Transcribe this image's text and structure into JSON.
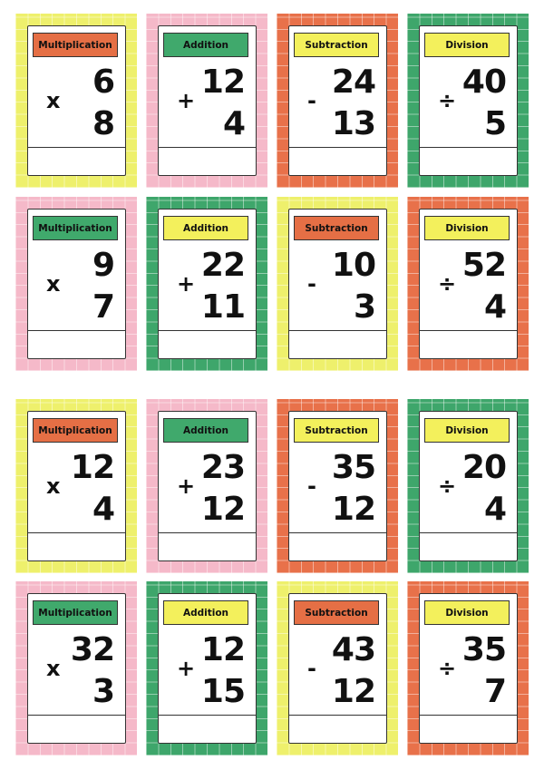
{
  "colors": {
    "yellow": "#eef06c",
    "pink": "#f5b9c9",
    "orange": "#e8714a",
    "green": "#3ea66b",
    "label_yellow": "#f3f05c",
    "label_orange": "#e56f45",
    "label_green": "#40a96c"
  },
  "cards": [
    {
      "label": "Multiplication",
      "top": "6",
      "bottom": "8",
      "op": "x",
      "bg": "yellow",
      "label_color": "label_orange"
    },
    {
      "label": "Addition",
      "top": "12",
      "bottom": "4",
      "op": "+",
      "bg": "pink",
      "label_color": "label_green"
    },
    {
      "label": "Subtraction",
      "top": "24",
      "bottom": "13",
      "op": "-",
      "bg": "orange",
      "label_color": "label_yellow"
    },
    {
      "label": "Division",
      "top": "40",
      "bottom": "5",
      "op": "÷",
      "bg": "green",
      "label_color": "label_yellow"
    },
    {
      "label": "Multiplication",
      "top": "9",
      "bottom": "7",
      "op": "x",
      "bg": "pink",
      "label_color": "label_green"
    },
    {
      "label": "Addition",
      "top": "22",
      "bottom": "11",
      "op": "+",
      "bg": "green",
      "label_color": "label_yellow"
    },
    {
      "label": "Subtraction",
      "top": "10",
      "bottom": "3",
      "op": "-",
      "bg": "yellow",
      "label_color": "label_orange"
    },
    {
      "label": "Division",
      "top": "52",
      "bottom": "4",
      "op": "÷",
      "bg": "orange",
      "label_color": "label_yellow"
    },
    {
      "label": "Multiplication",
      "top": "12",
      "bottom": "4",
      "op": "x",
      "bg": "yellow",
      "label_color": "label_orange"
    },
    {
      "label": "Addition",
      "top": "23",
      "bottom": "12",
      "op": "+",
      "bg": "pink",
      "label_color": "label_green"
    },
    {
      "label": "Subtraction",
      "top": "35",
      "bottom": "12",
      "op": "-",
      "bg": "orange",
      "label_color": "label_yellow"
    },
    {
      "label": "Division",
      "top": "20",
      "bottom": "4",
      "op": "÷",
      "bg": "green",
      "label_color": "label_yellow"
    },
    {
      "label": "Multiplication",
      "top": "32",
      "bottom": "3",
      "op": "x",
      "bg": "pink",
      "label_color": "label_green"
    },
    {
      "label": "Addition",
      "top": "12",
      "bottom": "15",
      "op": "+",
      "bg": "green",
      "label_color": "label_yellow"
    },
    {
      "label": "Subtraction",
      "top": "43",
      "bottom": "12",
      "op": "-",
      "bg": "yellow",
      "label_color": "label_orange"
    },
    {
      "label": "Division",
      "top": "35",
      "bottom": "7",
      "op": "÷",
      "bg": "orange",
      "label_color": "label_yellow"
    }
  ]
}
